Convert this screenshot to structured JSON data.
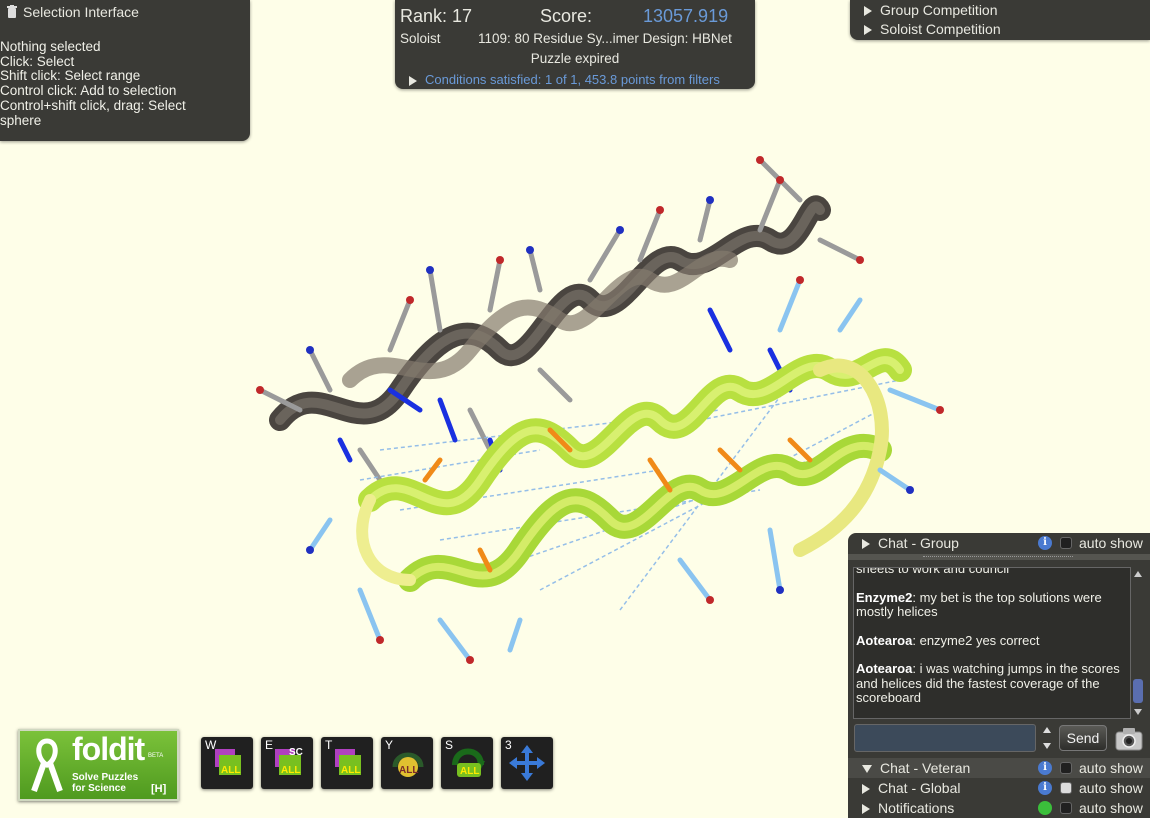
{
  "selection": {
    "title": "Selection Interface",
    "lines": [
      " Nothing selected",
      " Click: Select",
      " Shift click: Select range",
      " Control click: Add to selection",
      " Control+shift click, drag: Select",
      "sphere"
    ]
  },
  "score": {
    "rank": "Rank: 17",
    "score_label": "Score:",
    "score_value": "13057.919",
    "mode": "Soloist",
    "puzzle": "1109: 80 Residue Sy...imer Design: HBNet",
    "status": "Puzzle expired",
    "conditions": "Conditions satisfied: 1 of 1, 453.8 points from filters"
  },
  "competitions": [
    "Group Competition",
    "Soloist Competition"
  ],
  "chat": {
    "group": {
      "label": "Chat - Group",
      "auto": "auto show"
    },
    "messages": [
      {
        "user": "",
        "text": "sheets to work and council"
      },
      {
        "user": "Enzyme2",
        "text": ": my bet is the top solutions were mostly helices"
      },
      {
        "user": "Aotearoa",
        "text": ": enzyme2 yes correct"
      },
      {
        "user": "Aotearoa",
        "text": ": i was watching jumps in the scores and helices did the fastest coverage of the scoreboard"
      }
    ],
    "send": "Send",
    "veteran": {
      "label": "Chat - Veteran",
      "auto": "auto show"
    },
    "global": {
      "label": "Chat - Global",
      "auto": "auto show"
    },
    "notifications": {
      "label": "Notifications",
      "auto": "auto show"
    }
  },
  "logo": {
    "word": "foldit",
    "beta": "BETA",
    "tagline1": "Solve Puzzles",
    "tagline2": "for Science",
    "hotkey": "[H]"
  },
  "tools": [
    {
      "key": "W",
      "badge": "ALL",
      "icon": "wiggle-icon"
    },
    {
      "key": "E",
      "badge": "ALL",
      "extra": "SC",
      "icon": "wiggle-sidechains-icon"
    },
    {
      "key": "T",
      "badge": "ALL",
      "icon": "tweak-icon"
    },
    {
      "key": "Y",
      "badge": "ALL",
      "icon": "shake-icon"
    },
    {
      "key": "S",
      "badge": "ALL",
      "icon": "rebuild-icon"
    },
    {
      "key": "3",
      "icon": "move-icon"
    }
  ],
  "colors": {
    "panel": "#3a3a36",
    "accent": "#6a9ad8",
    "background": "#fefee8"
  }
}
